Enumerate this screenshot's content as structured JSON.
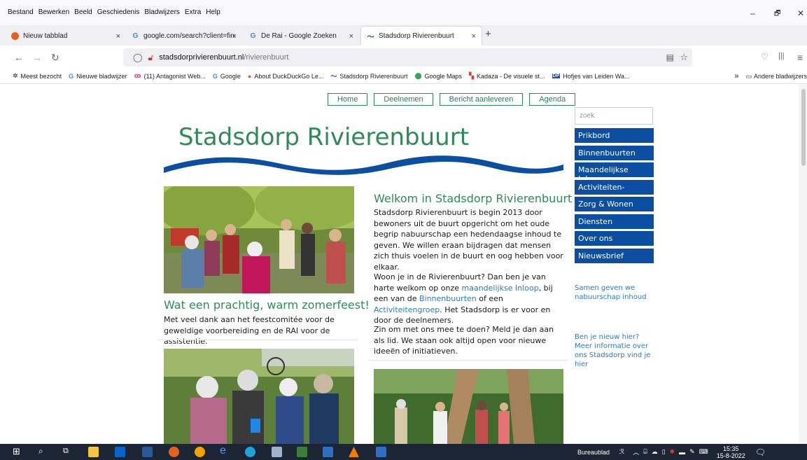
{
  "menu": [
    "Bestand",
    "Bewerken",
    "Beeld",
    "Geschiedenis",
    "Bladwijzers",
    "Extra",
    "Help"
  ],
  "window_controls": [
    "–",
    "🗗",
    "✕"
  ],
  "tabs": [
    {
      "label": "Nieuw tabblad",
      "icon": "firefox-icon",
      "close": "×"
    },
    {
      "label": "google.com/search?client=firef",
      "icon": "google-icon",
      "close": "×"
    },
    {
      "label": "De Rai - Google Zoeken",
      "icon": "google-icon",
      "close": "×"
    },
    {
      "label": "Stadsdorp Rivierenbuurt",
      "icon": "wave-icon",
      "close": "×"
    }
  ],
  "new_tab": "+",
  "nav": {
    "back": "←",
    "forward": "→",
    "reload": "↻"
  },
  "url": {
    "host": "stadsdorprivierenbuurt.nl",
    "path": "/rivierenbuurt"
  },
  "bookmarks": [
    {
      "label": "Meest bezocht",
      "icon": "gear-icon"
    },
    {
      "label": "Nieuwe bladwijzer",
      "icon": "google-icon"
    },
    {
      "label": "(11) Antagonist Web...",
      "icon": "antagonist-icon"
    },
    {
      "label": "Google",
      "icon": "google-icon"
    },
    {
      "label": "About DuckDuckGo Le...",
      "icon": "duckduckgo-icon"
    },
    {
      "label": "Stadsdorp Rivierenbuurt",
      "icon": "wave-icon"
    },
    {
      "label": "Google Maps",
      "icon": "map-pin-icon"
    },
    {
      "label": "Kadaza - De visuele st...",
      "icon": "kadaza-icon"
    },
    {
      "label": "Hofjes van Leiden Wa...",
      "icon": "hofjes-icon"
    }
  ],
  "bookmarks_more": "»",
  "bookmarks_other": "Andere bladwijzers",
  "site": {
    "topnav": [
      "Home",
      "Deelnemen",
      "Bericht aanleveren",
      "Agenda"
    ],
    "title": "Stadsdorp Rivierenbuurt",
    "left_heading": "Wat een prachtig, warm zomerfeest!",
    "left_text": "Met veel dank aan het feestcomitée voor de geweldige voorbereiding en de RAI voor de assistentie.",
    "right_heading": "Welkom in Stadsdorp Rivierenbuurt",
    "right_p1": "Stadsdorp Rivierenbuurt is begin 2013 door bewoners uit de buurt opgericht om het oude begrip nabuurschap een hedendaagse inhoud te geven. We willen eraan bijdragen dat mensen zich thuis voelen in de buurt en oog hebben voor elkaar.",
    "right_p2_a": "Woon je in de Rivierenbuurt? Dan ben je van harte welkom op onze ",
    "right_p2_link1": "maandelijkse Inloop",
    "right_p2_b": ", bij een van de ",
    "right_p2_link2": "Binnenbuurten",
    "right_p2_c": " of een ",
    "right_p2_link3": "Activiteitengroep",
    "right_p2_d": ". Het Stadsdorp is er voor en door de deelnemers.",
    "right_p3": "Zin om met ons mee te doen? Meld je dan aan als lid. We staan ook altijd open voor nieuwe ideeën of initiatieven.",
    "search_placeholder": "zoek",
    "sidebar": [
      "Prikbord",
      "Binnenbuurten",
      "Maandelijkse Inloop",
      "Activiteiten-groepen ▾",
      "Zorg & Wonen",
      "Diensten",
      "Over ons",
      "Nieuwsbrief"
    ],
    "side_link1": "Samen geven we nabuurschap inhoud",
    "side_link2": "Ben je nieuw hier? Meer informatie over ons Stadsdorp vind je hier"
  },
  "taskbar": {
    "desktop_label": "Bureaublad",
    "time": "15:35",
    "date": "15-8-2022"
  },
  "colors": {
    "brand_green": "#2e8b57",
    "brand_blue": "#0b4ea2",
    "link_blue": "#2a7bbf"
  }
}
